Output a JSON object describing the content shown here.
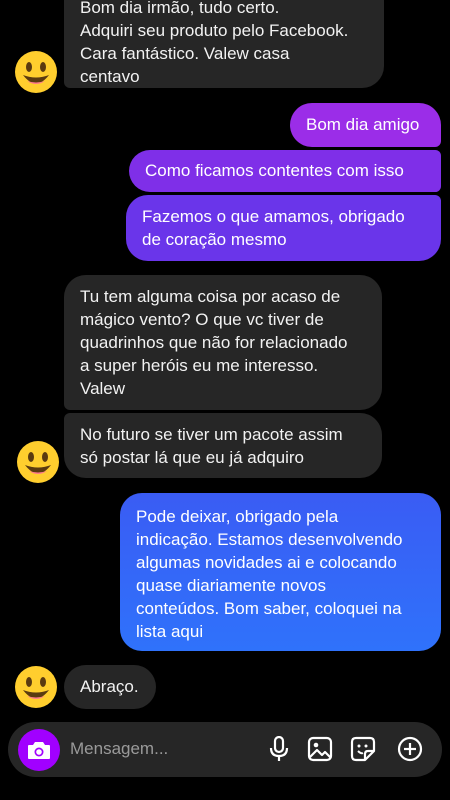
{
  "conversation": {
    "messages": [
      {
        "side": "incoming",
        "text": "Bom dia irmão, tudo certo.\nAdquiri seu produto pelo Facebook.\nCara fantástico. Valew casa\ncentavo"
      },
      {
        "side": "outgoing",
        "text": "Bom dia amigo"
      },
      {
        "side": "outgoing",
        "text": "Como ficamos contentes com isso"
      },
      {
        "side": "outgoing",
        "text": "Fazemos o que amamos, obrigado\nde coração mesmo"
      },
      {
        "side": "incoming",
        "text": "Tu tem alguma coisa por acaso de\nmágico vento? O que vc tiver de\nquadrinhos que não for relacionado\na super heróis eu me interesso.\nValew"
      },
      {
        "side": "incoming",
        "text": "No futuro se tiver um pacote assim\nsó postar lá que eu já adquiro"
      },
      {
        "side": "outgoing",
        "text": "Pode deixar, obrigado pela\nindicação. Estamos desenvolvendo\nalgumas novidades ai e colocando\nquase diariamente novos\nconteúdos. Bom saber, coloquei na\nlista aqui"
      },
      {
        "side": "incoming",
        "text": "Abraço."
      }
    ]
  },
  "composer": {
    "placeholder": "Mensagem...",
    "value": "",
    "camera_icon": "camera-icon",
    "icons": [
      "microphone-icon",
      "gallery-icon",
      "sticker-icon",
      "plus-circle-icon"
    ],
    "accent_color": "#a100ff"
  },
  "colors": {
    "incoming_bubble": "#262626",
    "outgoing_purple": "#7a2ce8",
    "outgoing_blue": "#2f6dfb",
    "background": "#000000"
  }
}
